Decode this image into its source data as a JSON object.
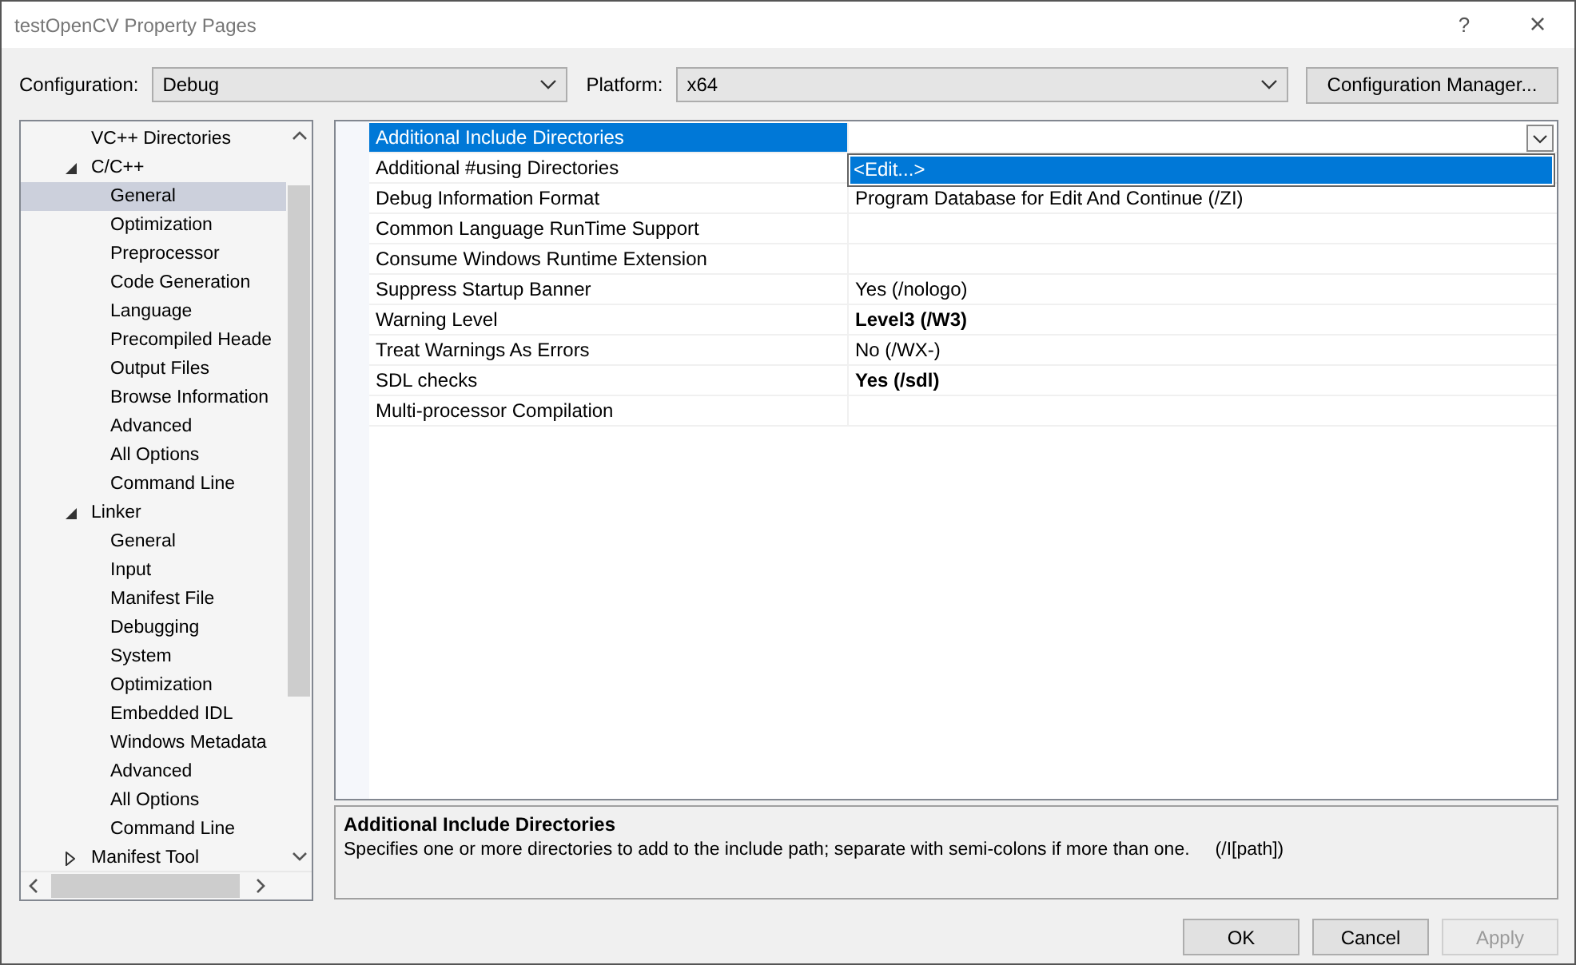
{
  "window": {
    "title": "testOpenCV Property Pages",
    "help": "?",
    "close": "×"
  },
  "config": {
    "configuration_label": "Configuration:",
    "configuration": "Debug",
    "platform_label": "Platform:",
    "platform": "x64",
    "manager_button": "Configuration Manager..."
  },
  "tree": [
    {
      "label": "VC++ Directories",
      "selected": false
    },
    {
      "label": "C/C++",
      "expanded": true,
      "selected": false,
      "children": [
        {
          "label": "General",
          "selected": true
        },
        {
          "label": "Optimization",
          "selected": false
        },
        {
          "label": "Preprocessor",
          "selected": false
        },
        {
          "label": "Code Generation",
          "selected": false
        },
        {
          "label": "Language",
          "selected": false
        },
        {
          "label": "Precompiled Heade",
          "selected": false
        },
        {
          "label": "Output Files",
          "selected": false
        },
        {
          "label": "Browse Information",
          "selected": false
        },
        {
          "label": "Advanced",
          "selected": false
        },
        {
          "label": "All Options",
          "selected": false
        },
        {
          "label": "Command Line",
          "selected": false
        }
      ]
    },
    {
      "label": "Linker",
      "expanded": true,
      "selected": false,
      "children": [
        {
          "label": "General",
          "selected": false
        },
        {
          "label": "Input",
          "selected": false
        },
        {
          "label": "Manifest File",
          "selected": false
        },
        {
          "label": "Debugging",
          "selected": false
        },
        {
          "label": "System",
          "selected": false
        },
        {
          "label": "Optimization",
          "selected": false
        },
        {
          "label": "Embedded IDL",
          "selected": false
        },
        {
          "label": "Windows Metadata",
          "selected": false
        },
        {
          "label": "Advanced",
          "selected": false
        },
        {
          "label": "All Options",
          "selected": false
        },
        {
          "label": "Command Line",
          "selected": false
        }
      ]
    },
    {
      "label": "Manifest Tool",
      "expanded": false,
      "selected": false
    }
  ],
  "properties": [
    {
      "name": "Additional Include Directories",
      "selected": true
    },
    {
      "name": "Additional #using Directories",
      "selected": false
    },
    {
      "name": "Debug Information Format",
      "value": "Program Database for Edit And Continue (/ZI)",
      "selected": false,
      "bold": false
    },
    {
      "name": "Common Language RunTime Support",
      "selected": false
    },
    {
      "name": "Consume Windows Runtime Extension",
      "selected": false
    },
    {
      "name": "Suppress Startup Banner",
      "value": "Yes (/nologo)",
      "selected": false,
      "bold": false
    },
    {
      "name": "Warning Level",
      "value": "Level3 (/W3)",
      "selected": false,
      "bold": true
    },
    {
      "name": "Treat Warnings As Errors",
      "value": "No (/WX-)",
      "selected": false,
      "bold": false
    },
    {
      "name": "SDL checks",
      "value": "Yes (/sdl)",
      "selected": false,
      "bold": true
    },
    {
      "name": "Multi-processor Compilation",
      "selected": false
    }
  ],
  "dropdown": {
    "open": true,
    "options": [
      {
        "label": "<Edit...>",
        "selected": true
      }
    ]
  },
  "description": {
    "title": "Additional Include Directories",
    "text": "Specifies one or more directories to add to the include path; separate with semi-colons if more than one.",
    "switch": "(/I[path])"
  },
  "buttons": [
    {
      "label": "OK",
      "disabled": false
    },
    {
      "label": "Cancel",
      "disabled": false
    },
    {
      "label": "Apply",
      "disabled": true
    }
  ]
}
